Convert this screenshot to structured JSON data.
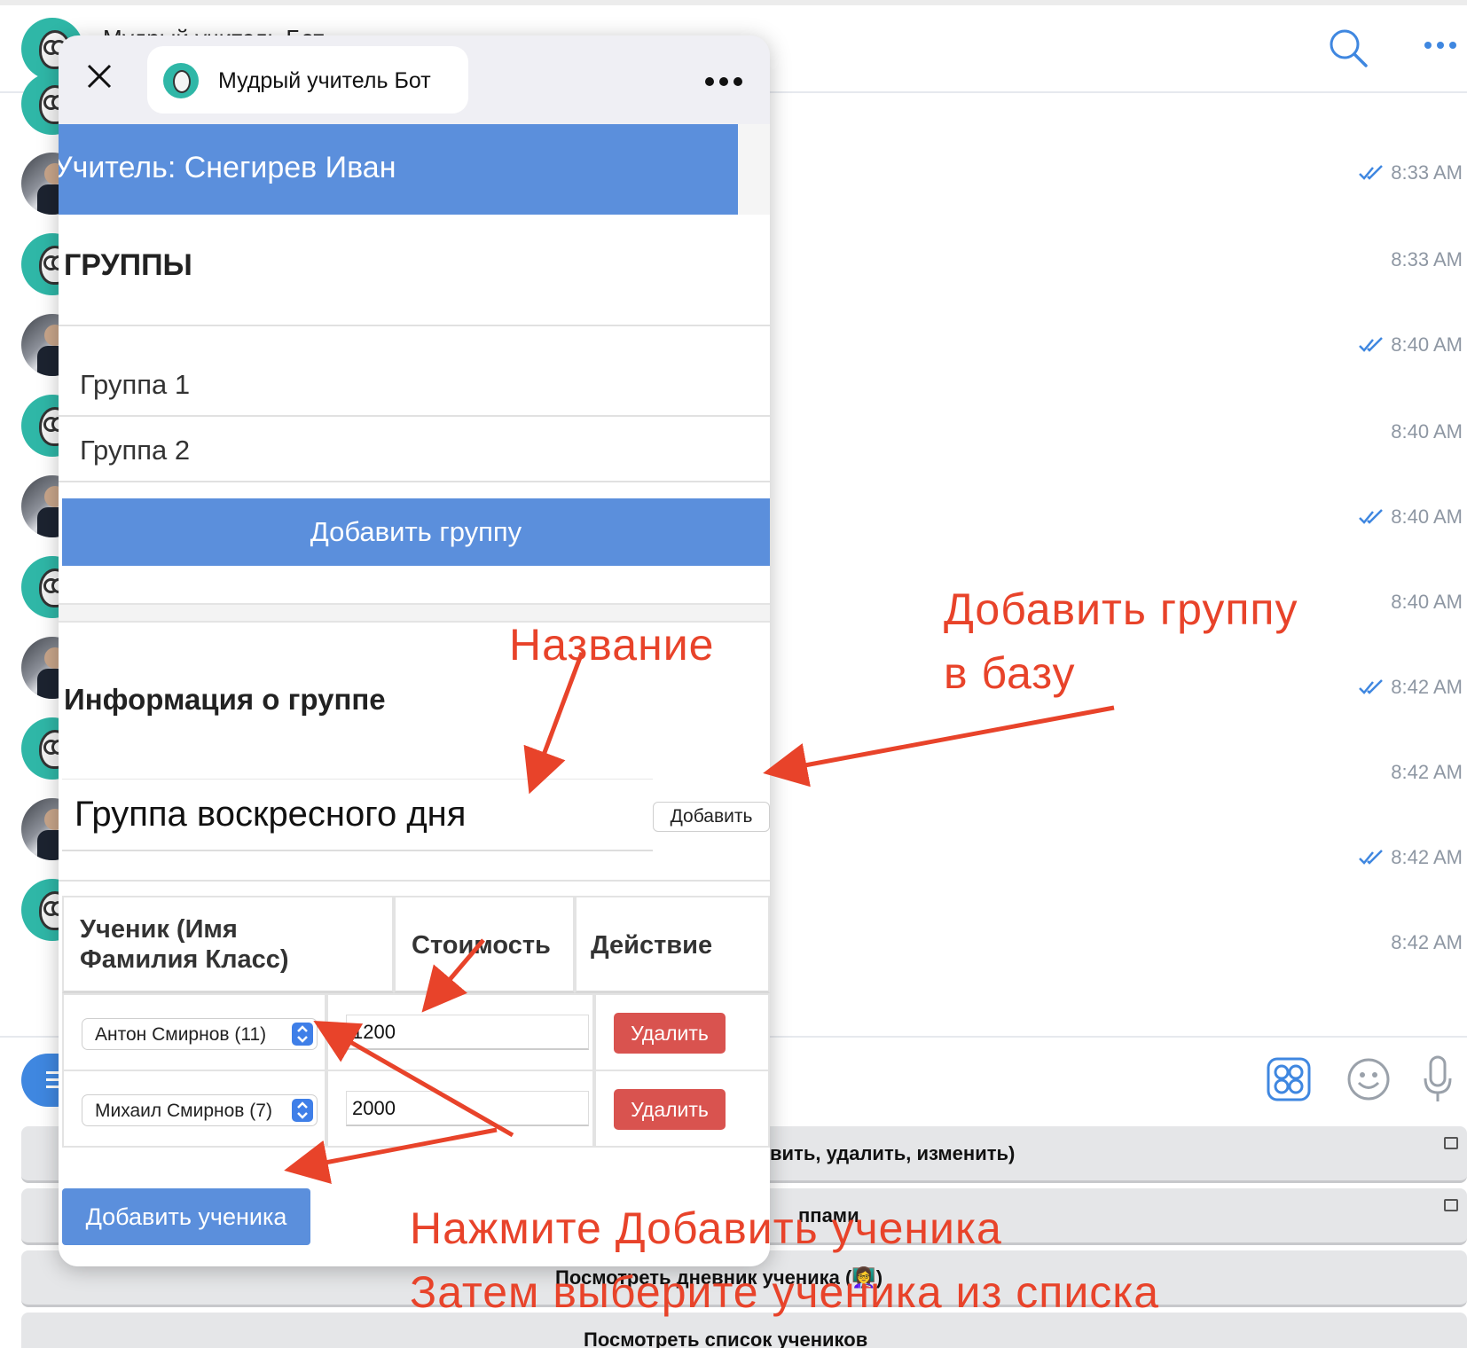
{
  "chat": {
    "title": "Мудрый учитель Бот",
    "messages": [
      {
        "sender": "bot",
        "time": ""
      },
      {
        "sender": "user",
        "time": "8:33 AM",
        "read": true
      },
      {
        "sender": "bot",
        "time": "8:33 AM"
      },
      {
        "sender": "user",
        "time": "8:40 AM",
        "read": true
      },
      {
        "sender": "bot",
        "time": "8:40 AM"
      },
      {
        "sender": "user",
        "time": "8:40 AM",
        "read": true
      },
      {
        "sender": "bot",
        "time": "8:40 AM"
      },
      {
        "sender": "user",
        "time": "8:42 AM",
        "read": true
      },
      {
        "sender": "bot",
        "time": "8:42 AM"
      },
      {
        "sender": "user",
        "time": "8:42 AM",
        "read": true
      },
      {
        "sender": "bot",
        "time": "8:42 AM"
      }
    ],
    "keyboard": [
      {
        "label": "вить, удалить, изменить)"
      },
      {
        "label": "ппами"
      },
      {
        "label": "Посмотреть дневник ученика (👩‍🏫)"
      },
      {
        "label": "Посмотреть список учеников"
      }
    ]
  },
  "webapp": {
    "title": "Мудрый учитель Бот",
    "teacher": "Учитель: Снегирев Иван",
    "groups_heading": "ГРУППЫ",
    "groups": [
      "Группа 1",
      "Группа 2"
    ],
    "add_group_label": "Добавить группу",
    "info_heading": "Информация о группе",
    "group_name_value": "Группа воскресного дня",
    "add_label": "Добавить",
    "table": {
      "headers": [
        "Ученик (Имя Фамилия Класс)",
        "Стоимость",
        "Действие"
      ],
      "header_student_lines": [
        "Ученик (Имя",
        "Фамилия Класс)"
      ],
      "rows": [
        {
          "student": "Антон Смирнов (11)",
          "price": "1200",
          "action": "Удалить"
        },
        {
          "student": "Михаил Смирнов (7)",
          "price": "2000",
          "action": "Удалить"
        }
      ]
    },
    "add_student_label": "Добавить ученика"
  },
  "annotations": {
    "name": "Название",
    "add_group_line1": "Добавить группу",
    "add_group_line2": "в базу",
    "press_add_student": "Нажмите Добавить ученика",
    "then_choose": "Затем выберите ученика из списка"
  },
  "colors": {
    "accent_blue": "#5b8fdc",
    "delete_red": "#d9534f",
    "annotation_red": "#e8432a",
    "bot_avatar": "#2fb7a7"
  }
}
